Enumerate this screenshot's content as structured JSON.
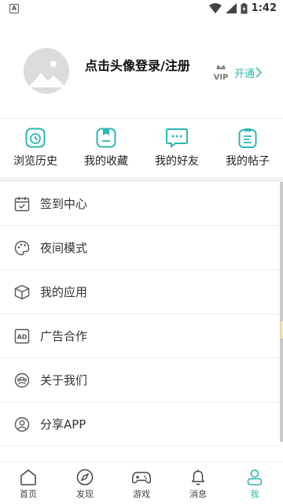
{
  "status_bar": {
    "time": "1:42",
    "notification_icon_text": "A"
  },
  "profile": {
    "login_text": "点击头像登录/注册",
    "vip_text": "VIP",
    "open_label": "开通"
  },
  "quick_actions": [
    {
      "label": "浏览历史",
      "icon": "history-icon"
    },
    {
      "label": "我的收藏",
      "icon": "favorites-icon"
    },
    {
      "label": "我的好友",
      "icon": "friends-icon"
    },
    {
      "label": "我的帖子",
      "icon": "posts-icon"
    }
  ],
  "menu": [
    {
      "label": "签到中心",
      "icon": "calendar-check-icon"
    },
    {
      "label": "夜间模式",
      "icon": "palette-icon"
    },
    {
      "label": "我的应用",
      "icon": "box-icon"
    },
    {
      "label": "广告合作",
      "icon": "ad-icon",
      "icon_text": "AD"
    },
    {
      "label": "关于我们",
      "icon": "group-icon"
    },
    {
      "label": "分享APP",
      "icon": "user-circle-icon"
    }
  ],
  "tabbar": {
    "items": [
      {
        "label": "首页",
        "icon": "home-icon"
      },
      {
        "label": "发现",
        "icon": "compass-icon"
      },
      {
        "label": "游戏",
        "icon": "gamepad-icon"
      },
      {
        "label": "消息",
        "icon": "bell-icon"
      },
      {
        "label": "我",
        "icon": "person-icon"
      }
    ],
    "active_index": 4
  },
  "colors": {
    "accent": "#2bb9b0",
    "text": "#333333",
    "icon_gray": "#555555"
  }
}
